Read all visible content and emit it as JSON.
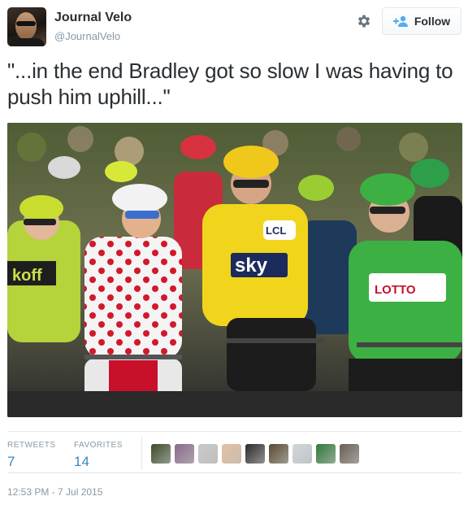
{
  "account": {
    "name": "Journal Velo",
    "handle": "@JournalVelo"
  },
  "header": {
    "follow_label": "Follow"
  },
  "tweet": {
    "text": "\"...in the end Bradley got so slow I was having to push him uphill...\""
  },
  "stats": {
    "retweets_label": "RETWEETS",
    "retweets_value": "7",
    "favorites_label": "FAVORITES",
    "favorites_value": "14"
  },
  "favoriters": [
    "#3a4a2a",
    "#8a6a8a",
    "#c9c9c9",
    "#e6c0a0",
    "#2a2a2a",
    "#5a4a30",
    "#d0d8dc",
    "#2f7a3a",
    "#6b6052"
  ],
  "timestamp": "12:53 PM - 7 Jul 2015",
  "colors": {
    "link": "#3b88c3",
    "muted": "#8899a6",
    "text": "#292f33"
  }
}
